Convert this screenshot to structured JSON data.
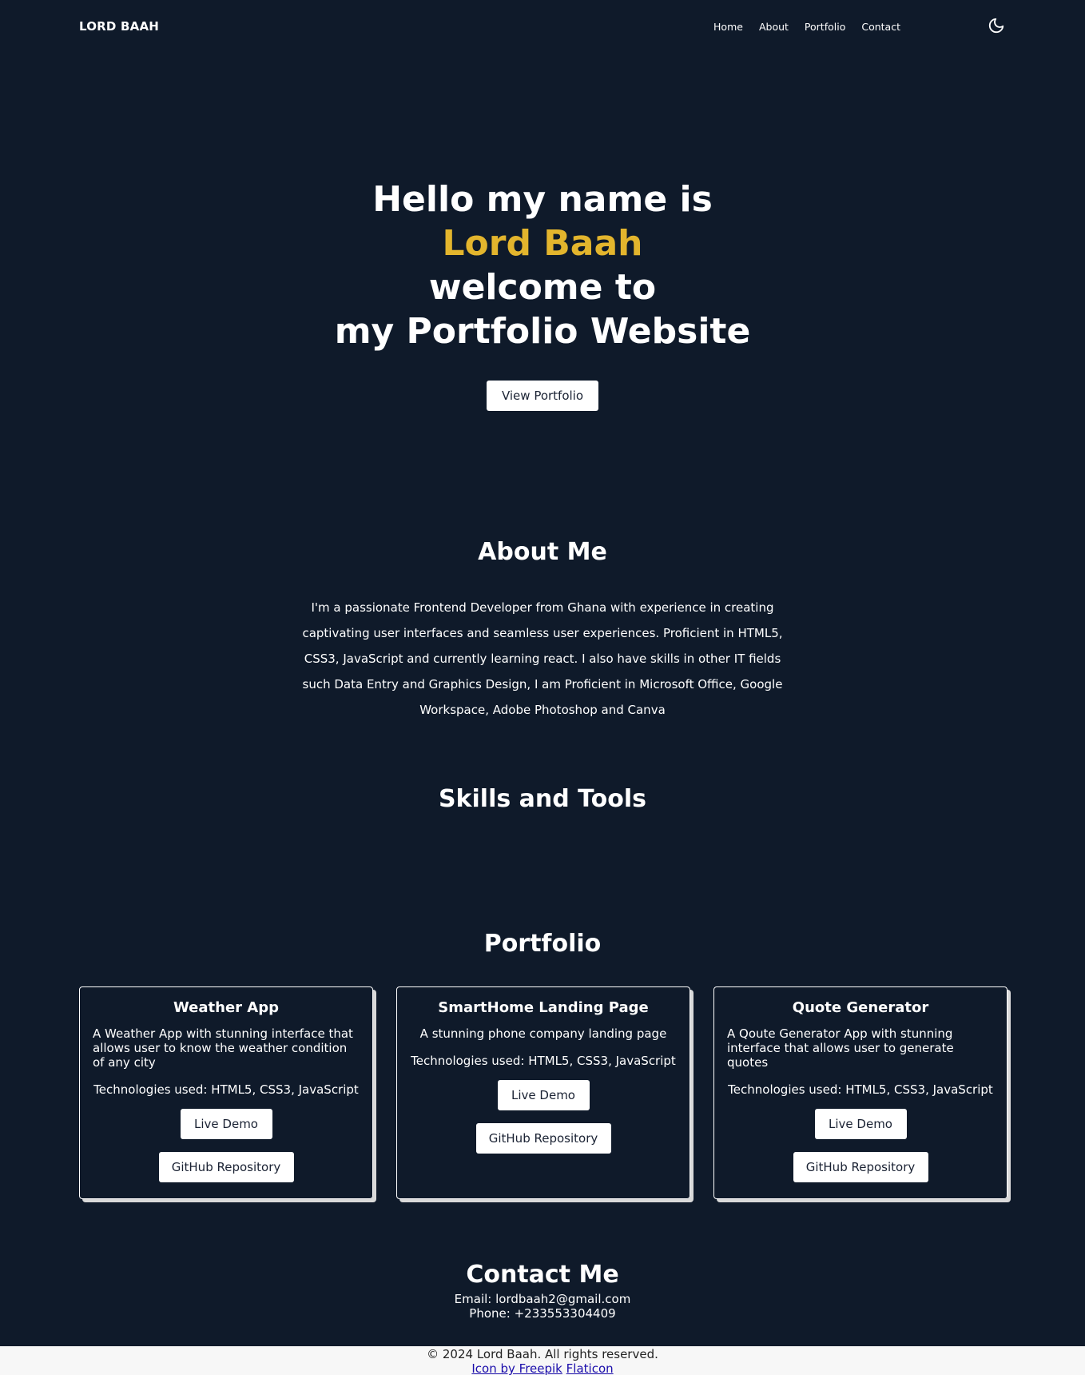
{
  "nav": {
    "brand": "LORD BAAH",
    "links": [
      "Home",
      "About",
      "Portfolio",
      "Contact"
    ],
    "theme_icon": "moon-icon"
  },
  "hero": {
    "line1": "Hello my name is",
    "name": "Lord Baah",
    "line3": "welcome to",
    "line4": "my Portfolio Website",
    "button": "View Portfolio",
    "accent_color": "#e3b52d"
  },
  "about": {
    "title": "About Me",
    "text": "I'm a passionate Frontend Developer from Ghana with experience in creating captivating user interfaces and seamless user experiences. Proficient in HTML5, CSS3, JavaScript and currently learning react. I also have skills in other IT fields such Data Entry and Graphics Design, I am Proficient in Microsoft Office, Google Workspace, Adobe Photoshop and Canva"
  },
  "skills": {
    "title": "Skills and Tools"
  },
  "portfolio": {
    "title": "Portfolio",
    "cards": [
      {
        "title": "Weather App",
        "description": "A Weather App with stunning interface that allows user to know the weather condition of any city",
        "tech": "Technologies used: HTML5, CSS3, JavaScript",
        "demo": "Live Demo",
        "repo": "GitHub Repository"
      },
      {
        "title": "SmartHome Landing Page",
        "description": "A stunning phone company landing page",
        "tech": "Technologies used: HTML5, CSS3, JavaScript",
        "demo": "Live Demo",
        "repo": "GitHub Repository"
      },
      {
        "title": "Quote Generator",
        "description": "A Qoute Generator App with stunning interface that allows user to generate quotes",
        "tech": "Technologies used: HTML5, CSS3, JavaScript",
        "demo": "Live Demo",
        "repo": "GitHub Repository"
      }
    ]
  },
  "contact": {
    "title": "Contact Me",
    "email": "Email: lordbaah2@gmail.com",
    "phone": "Phone: +233553304409"
  },
  "footer": {
    "copyright": "© 2024 Lord Baah. All rights reserved.",
    "icon_credit_1": "Icon by Freepik",
    "icon_credit_2": "Flaticon"
  },
  "colors": {
    "background": "#0f1a2a",
    "accent": "#e3b52d",
    "footer_bg": "#f7f7f7",
    "link": "#1a0dab"
  }
}
